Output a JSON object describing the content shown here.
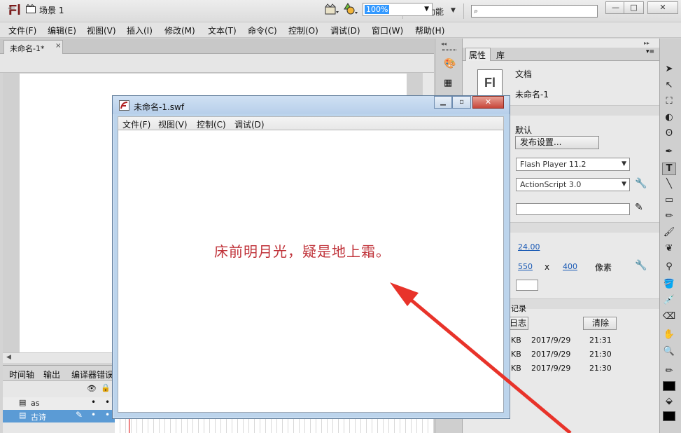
{
  "app": {
    "logo": "Fl",
    "workspace": "基本功能",
    "search_placeholder": ""
  },
  "menu": [
    "文件(F)",
    "编辑(E)",
    "视图(V)",
    "插入(I)",
    "修改(M)",
    "文本(T)",
    "命令(C)",
    "控制(O)",
    "调试(D)",
    "窗口(W)",
    "帮助(H)"
  ],
  "doc_tab": {
    "label": "未命名-1*",
    "close": "×"
  },
  "scene": {
    "label": "场景 1",
    "zoom": "100%"
  },
  "timeline": {
    "tabs": [
      "时间轴",
      "输出",
      "编译器错误"
    ],
    "layers": [
      {
        "name": "as"
      },
      {
        "name": "古诗"
      }
    ]
  },
  "properties": {
    "tabs": [
      "属性",
      "库"
    ],
    "doc_type": "文档",
    "doc_name": "未命名-1",
    "profile": "默认",
    "publish_settings": "发布设置...",
    "player": "Flash Player 11.2",
    "script": "ActionScript 3.0",
    "fps": "24.00",
    "width": "550",
    "times": "x",
    "height": "400",
    "unit": "像素",
    "history_label": "记录",
    "log_button": "日志",
    "clear_button": "清除",
    "history": [
      {
        "size": "KB",
        "date": "2017/9/29",
        "time": "21:31"
      },
      {
        "size": "KB",
        "date": "2017/9/29",
        "time": "21:30"
      },
      {
        "size": "KB",
        "date": "2017/9/29",
        "time": "21:30"
      }
    ]
  },
  "swf": {
    "title": "未命名-1.swf",
    "menu": [
      "文件(F)",
      "视图(V)",
      "控制(C)",
      "调试(D)"
    ],
    "poem": "床前明月光，疑是地上霜。"
  },
  "colors": {
    "poem": "#c0333a",
    "arrow": "#e8332a",
    "selection": "#3399ff"
  }
}
